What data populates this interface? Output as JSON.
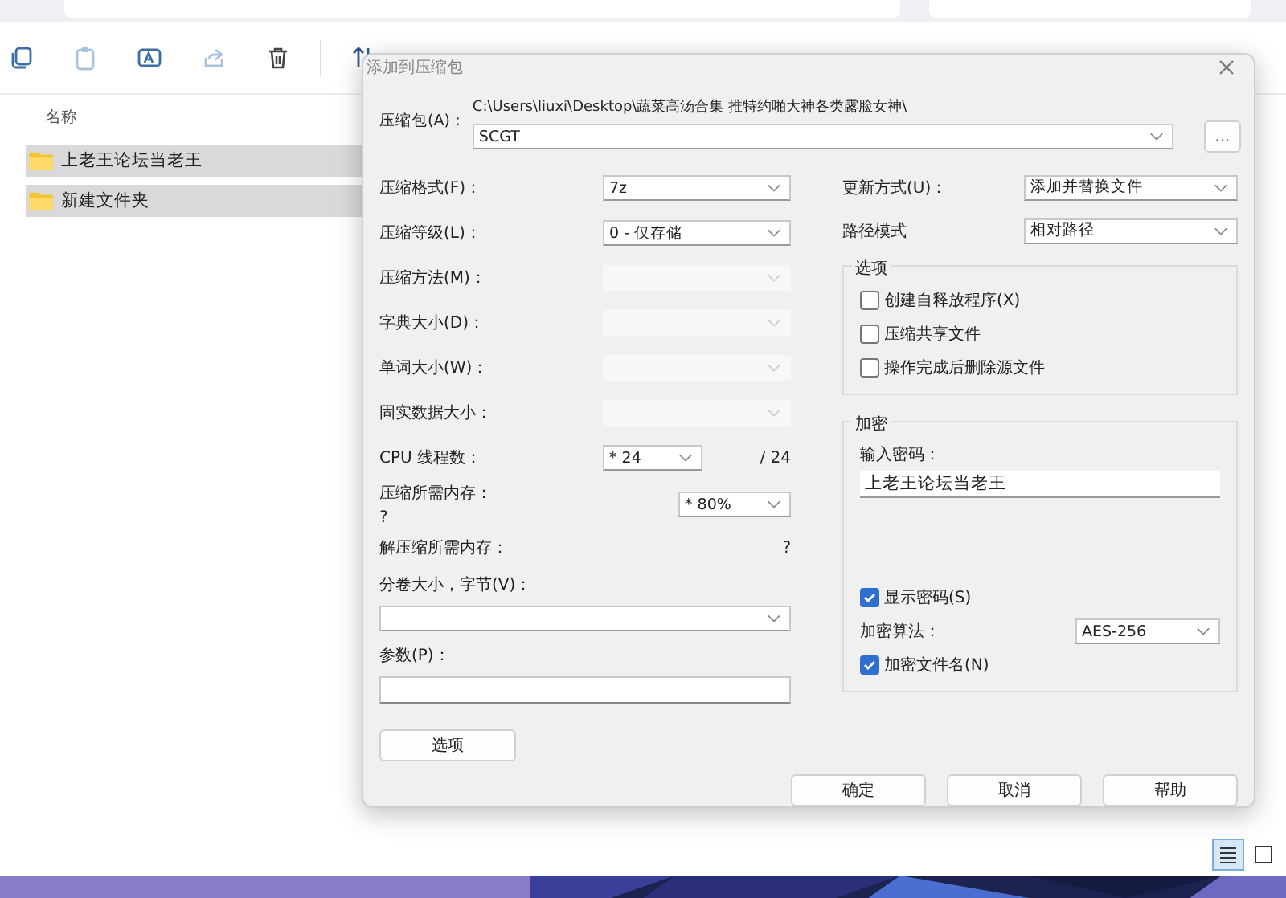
{
  "explorer": {
    "column_header": "名称",
    "items": [
      {
        "name": "上老王论坛当老王",
        "selected": true
      },
      {
        "name": "新建文件夹",
        "selected": true
      }
    ],
    "view_modes": [
      {
        "selected": true
      },
      {
        "selected": false
      }
    ]
  },
  "dialog": {
    "title": "添加到压缩包",
    "archive_label": "压缩包(A)：",
    "path": "C:\\Users\\liuxi\\Desktop\\蔬菜高汤合集 推特约啪大神各类露脸女神\\",
    "archive_name": "SCGT",
    "browse": "...",
    "left_fields": [
      {
        "kind": "select",
        "label": "压缩格式(F)：",
        "value": "7z",
        "disabled": false
      },
      {
        "kind": "select",
        "label": "压缩等级(L)：",
        "value": "0 - 仅存储",
        "disabled": false
      },
      {
        "kind": "select",
        "label": "压缩方法(M)：",
        "disabled": true
      },
      {
        "kind": "select",
        "label": "字典大小(D)：",
        "disabled": true
      },
      {
        "kind": "select",
        "label": "单词大小(W)：",
        "disabled": true
      },
      {
        "kind": "select",
        "label": "固实数据大小：",
        "disabled": true
      },
      {
        "kind": "threads",
        "label": "CPU 线程数：",
        "value": "* 24",
        "suffix": "/ 24",
        "disabled": false
      },
      {
        "kind": "memory",
        "label": "压缩所需内存：",
        "sub": "?",
        "value": "* 80%",
        "disabled": false
      },
      {
        "kind": "info",
        "label": "解压缩所需内存：",
        "value": "?"
      },
      {
        "kind": "wide_select",
        "label": "分卷大小，字节(V)："
      },
      {
        "kind": "wide_input",
        "label": "参数(P)："
      }
    ],
    "options_button": "选项",
    "right_fields": [
      {
        "label": "更新方式(U)：",
        "value": "添加并替换文件"
      },
      {
        "label": "路径模式",
        "value": "相对路径"
      }
    ],
    "options_group": {
      "title": "选项",
      "checkboxes": [
        {
          "label": "创建自释放程序(X)",
          "checked": false
        },
        {
          "label": "压缩共享文件",
          "checked": false
        },
        {
          "label": "操作完成后删除源文件",
          "checked": false
        }
      ]
    },
    "encryption": {
      "title": "加密",
      "password_label": "输入密码：",
      "password": "上老王论坛当老王",
      "show_password": {
        "label": "显示密码(S)",
        "checked": true
      },
      "method_label": "加密算法：",
      "method": "AES-256",
      "encrypt_names": {
        "label": "加密文件名(N)",
        "checked": true
      }
    },
    "buttons": [
      "确定",
      "取消",
      "帮助"
    ]
  }
}
